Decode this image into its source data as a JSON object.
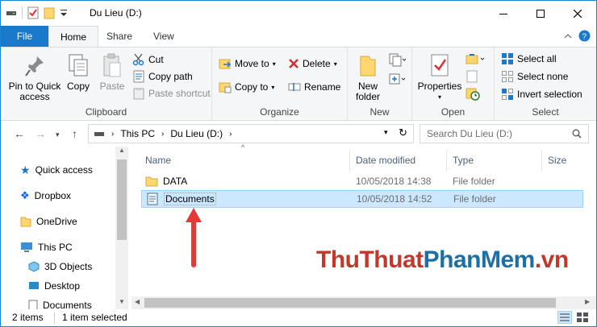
{
  "window": {
    "title": "Du Lieu (D:)"
  },
  "tabs": [
    "File",
    "Home",
    "Share",
    "View"
  ],
  "ribbon": {
    "clipboard": {
      "label": "Clipboard",
      "pin": "Pin to Quick access",
      "copy": "Copy",
      "paste": "Paste",
      "cut": "Cut",
      "copy_path": "Copy path",
      "paste_shortcut": "Paste shortcut"
    },
    "organize": {
      "label": "Organize",
      "move_to": "Move to",
      "copy_to": "Copy to",
      "delete": "Delete",
      "rename": "Rename"
    },
    "new": {
      "label": "New",
      "new_folder": "New folder"
    },
    "open": {
      "label": "Open",
      "properties": "Properties"
    },
    "select": {
      "label": "Select",
      "select_all": "Select all",
      "select_none": "Select none",
      "invert": "Invert selection"
    }
  },
  "address": {
    "crumbs": [
      "This PC",
      "Du Lieu (D:)"
    ],
    "search_placeholder": "Search Du Lieu (D:)"
  },
  "nav": [
    "Quick access",
    "Dropbox",
    "OneDrive",
    "This PC",
    "3D Objects",
    "Desktop",
    "Documents"
  ],
  "columns": [
    "Name",
    "Date modified",
    "Type",
    "Size"
  ],
  "files": [
    {
      "name": "DATA",
      "date": "10/05/2018 14:38",
      "type": "File folder",
      "icon": "folder-icon"
    },
    {
      "name": "Documents",
      "date": "10/05/2018 14:52",
      "type": "File folder",
      "icon": "document-icon",
      "selected": true
    }
  ],
  "status": {
    "items": "2 items",
    "selected": "1 item selected"
  },
  "watermark": {
    "part1": "ThuThuat",
    "part2": "PhanMem",
    "part3": ".vn"
  },
  "colors": {
    "accent": "#1979ca",
    "selection": "#cce8ff",
    "folder": "#ffd76e",
    "arrow": "#e53935"
  }
}
